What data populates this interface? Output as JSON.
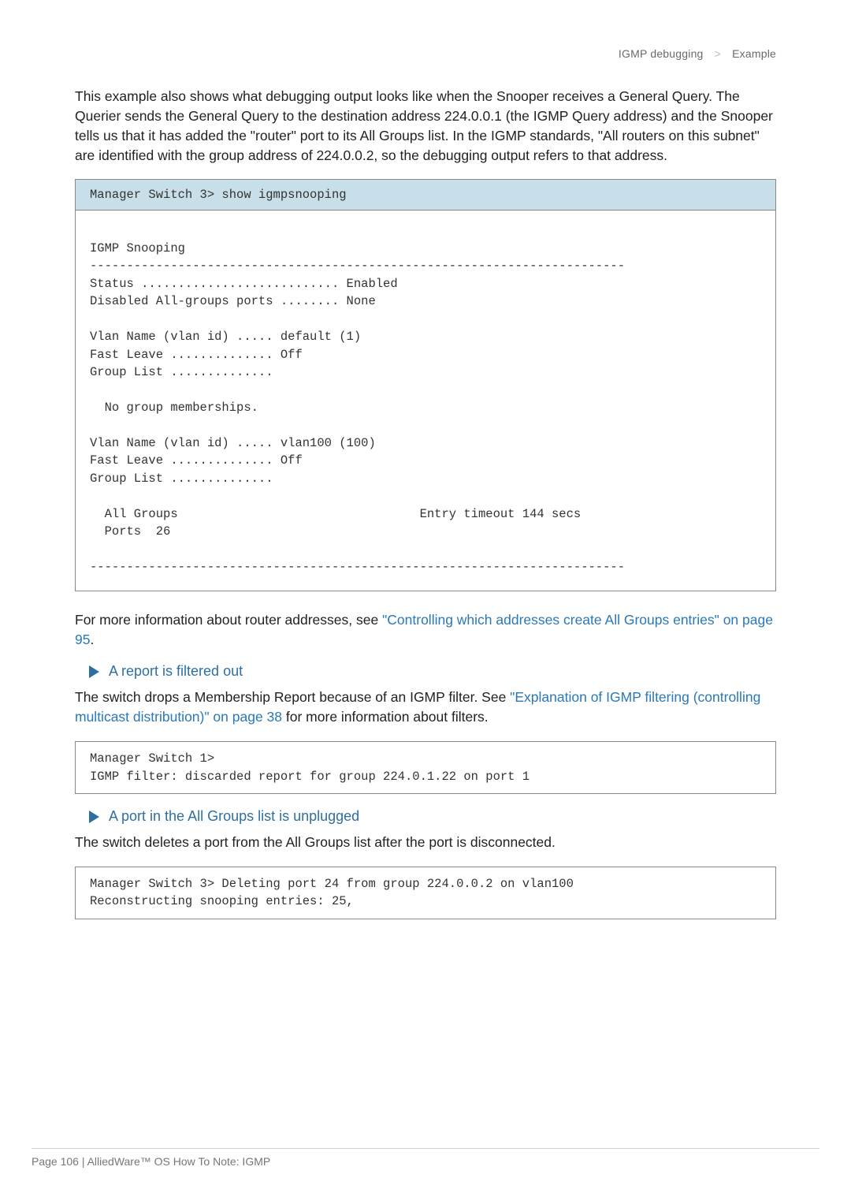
{
  "header": {
    "left": "IGMP debugging",
    "right": "Example"
  },
  "para1": "This example also shows what debugging output looks like when the Snooper receives a General Query. The Querier sends the General Query to the destination address 224.0.0.1 (the IGMP Query address) and the Snooper tells us that it has added the \"router\" port to its All Groups list. In the IGMP standards, \"All routers on this subnet\" are identified with the group address of 224.0.0.2, so the debugging output refers to that address.",
  "code1": {
    "header": "Manager Switch 3> show igmpsnooping",
    "body": "\nIGMP Snooping\n-------------------------------------------------------------------------\nStatus ........................... Enabled\nDisabled All-groups ports ........ None\n\nVlan Name (vlan id) ..... default (1)\nFast Leave .............. Off\nGroup List ..............\n\n  No group memberships.\n\nVlan Name (vlan id) ..... vlan100 (100)\nFast Leave .............. Off\nGroup List ..............\n\n  All Groups                                 Entry timeout 144 secs\n  Ports  26\n\n-------------------------------------------------------------------------"
  },
  "para2_pre": "For more information about router addresses, see ",
  "para2_link": "\"Controlling which addresses create All Groups entries\" on page 95",
  "para2_post": ".",
  "heading1": "A report is filtered out",
  "para3_pre": "The switch drops a Membership Report because of an IGMP filter. See ",
  "para3_link": "\"Explanation of IGMP filtering (controlling multicast distribution)\" on page 38",
  "para3_post": " for more information about filters.",
  "code2": {
    "body": "Manager Switch 1>\nIGMP filter: discarded report for group 224.0.1.22 on port 1"
  },
  "heading2": "A port in the All Groups list is unplugged",
  "para4": "The switch deletes a port from the All Groups list after the port is disconnected.",
  "code3": {
    "body": "Manager Switch 3> Deleting port 24 from group 224.0.0.2 on vlan100\nReconstructing snooping entries: 25,"
  },
  "footer": "Page 106 | AlliedWare™ OS How To Note: IGMP"
}
